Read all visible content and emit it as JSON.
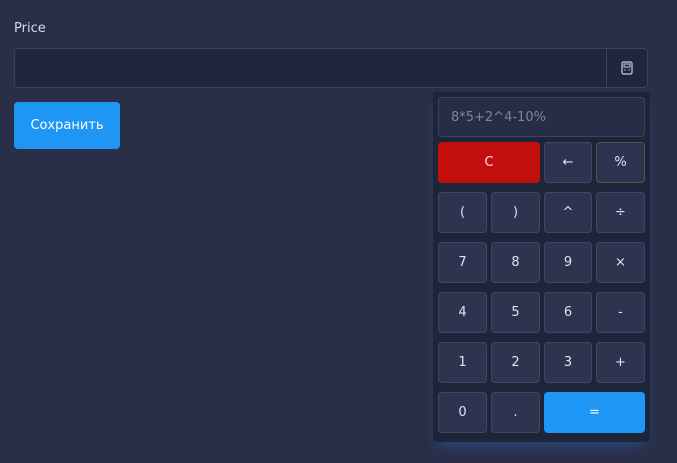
{
  "form": {
    "price_label": "Price",
    "price_value": "",
    "save_label": "Сохранить"
  },
  "calculator": {
    "display_text": "8*5+2^4-10%",
    "keys": {
      "clear": "C",
      "backspace": "←",
      "percent": "%",
      "paren_open": "(",
      "paren_close": ")",
      "power": "^",
      "divide": "÷",
      "seven": "7",
      "eight": "8",
      "nine": "9",
      "multiply": "×",
      "four": "4",
      "five": "5",
      "six": "6",
      "minus": "-",
      "one": "1",
      "two": "2",
      "three": "3",
      "plus": "+",
      "zero": "0",
      "decimal": ".",
      "equals": "="
    }
  },
  "colors": {
    "page_bg": "#2a2f48",
    "accent": "#1e96f5",
    "danger": "#c30e0e",
    "panel_bg": "#1e253b"
  },
  "icons": {
    "calc_toggle": "calculator-icon"
  }
}
